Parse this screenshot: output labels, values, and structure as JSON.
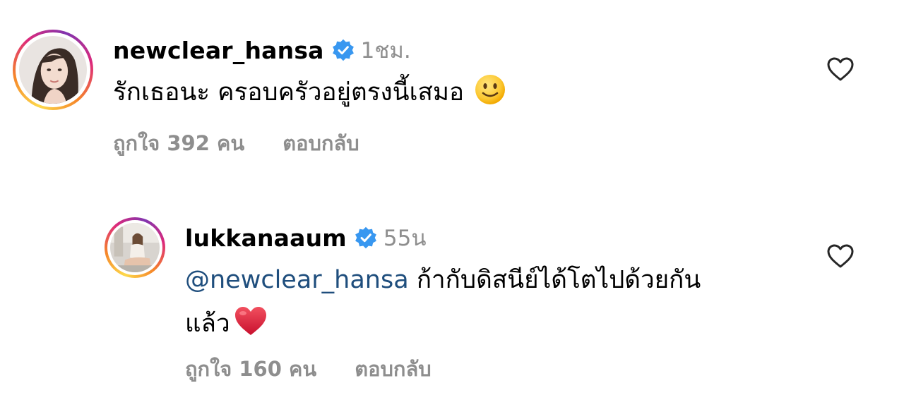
{
  "comments": [
    {
      "username": "newclear_hansa",
      "time": "1ชม.",
      "text": "รักเธอนะ ครอบครัวอยู่ตรงนี้เสมอ",
      "emoji": "slightly-smiling-face",
      "likes": "ถูกใจ 392 คน",
      "reply": "ตอบกลับ"
    },
    {
      "username": "lukkanaaum",
      "time": "55น",
      "mention": "@newclear_hansa",
      "text_line1": "ก้ากับดิสนีย์ได้โตไปด้วยกัน",
      "text_line2": "แล้ว",
      "emoji": "red-heart",
      "likes": "ถูกใจ 160 คน",
      "reply": "ตอบกลับ"
    }
  ],
  "icons": {
    "verified": "verified-badge-icon",
    "like": "heart-outline-icon"
  },
  "colors": {
    "verified": "#3897f0",
    "secondary_text": "#8e8e8e",
    "mention": "#1f4e7d",
    "heart_emoji": "#e0243a"
  }
}
